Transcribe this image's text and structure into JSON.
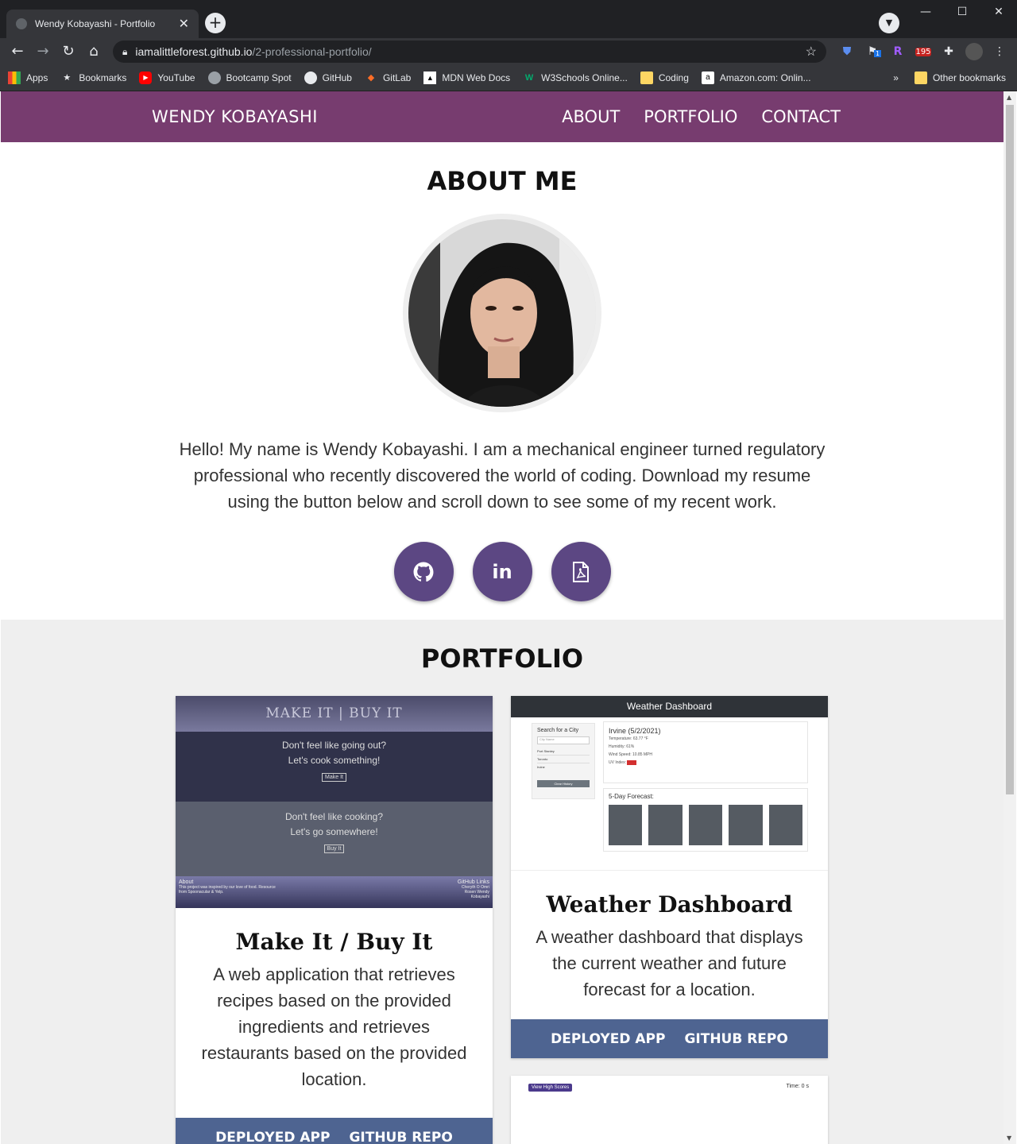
{
  "browser": {
    "tab_title": "Wendy Kobayashi - Portfolio",
    "url_host": "iamalittleforest.github.io",
    "url_path": "/2-professional-portfolio/",
    "bookmarks": [
      "Apps",
      "Bookmarks",
      "YouTube",
      "Bootcamp Spot",
      "GitHub",
      "GitLab",
      "MDN Web Docs",
      "W3Schools Online...",
      "Coding",
      "Amazon.com: Onlin..."
    ],
    "other_bookmarks": "Other bookmarks",
    "mail_badge": "195",
    "ext_badge": "1"
  },
  "nav": {
    "brand": "WENDY KOBAYASHI",
    "items": [
      "ABOUT",
      "PORTFOLIO",
      "CONTACT"
    ]
  },
  "about": {
    "heading": "ABOUT ME",
    "bio": "Hello! My name is Wendy Kobayashi. I am a mechanical engineer turned regulatory professional who recently discovered the world of coding. Download my resume using the button below and scroll down to see some of my recent work.",
    "social_icons": [
      "github-icon",
      "linkedin-icon",
      "pdf-icon"
    ]
  },
  "portfolio": {
    "heading": "PORTFOLIO",
    "projects": [
      {
        "title": "Make It / Buy It",
        "description": "A web application that retrieves recipes based on the provided ingredients and retrieves restaurants based on the provided location.",
        "deployed_label": "DEPLOYED APP",
        "repo_label": "GITHUB REPO",
        "thumb": {
          "header": "MAKE IT | BUY IT",
          "line1": "Don't feel like going out?",
          "line2": "Let's cook something!",
          "btn1": "Make It",
          "line3": "Don't feel like cooking?",
          "line4": "Let's go somewhere!",
          "btn2": "Buy It",
          "footer_left": "About",
          "footer_left_sub": "This project was inspired by our love of food. Resource from Spoonacular & Yelp.",
          "footer_right": "GitHub Links",
          "footer_right_sub": "Cheryth O  Omri Rosen  Wendy Kobayashi"
        }
      },
      {
        "title": "Weather Dashboard",
        "description": "A weather dashboard that displays the current weather and future forecast for a location.",
        "deployed_label": "DEPLOYED APP",
        "repo_label": "GITHUB REPO",
        "thumb": {
          "header": "Weather Dashboard",
          "search_label": "Search for a City",
          "placeholder": "City Name",
          "history": [
            "Port Stanley",
            "Toronto",
            "Irvine"
          ],
          "clear": "Clear History",
          "city": "Irvine (5/2/2021)",
          "temp": "Temperature: 63.77 °F",
          "humidity": "Humidity: 61%",
          "wind": "Wind Speed: 10.85 MPH",
          "uv": "UV Index:",
          "forecast_label": "5-Day Forecast:"
        }
      },
      {
        "thumb": {
          "high_scores": "View High Scores",
          "time": "Time: 0 s"
        }
      }
    ]
  }
}
